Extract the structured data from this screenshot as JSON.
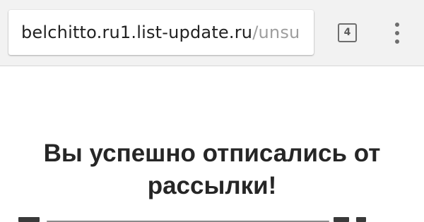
{
  "browser": {
    "url_host": "belchitto.ru1.list-update.ru",
    "url_path": "/unsu",
    "tab_count": "4"
  },
  "page": {
    "heading": "Вы успешно отписались от рассылки!"
  }
}
